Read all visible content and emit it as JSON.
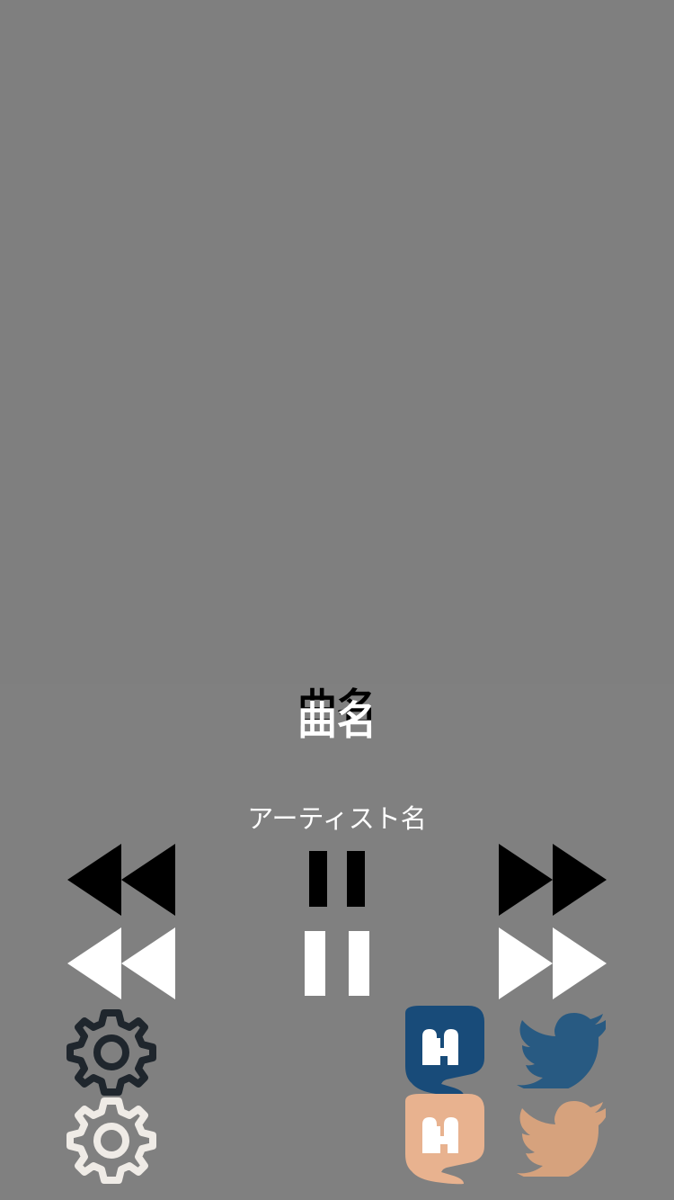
{
  "song": {
    "title": "曲名"
  },
  "artist": {
    "name": "アーティスト名"
  },
  "controls": {
    "previous_icon": "rewind-icon",
    "play_pause_icon": "pause-icon",
    "next_icon": "fast-forward-icon"
  },
  "footer": {
    "settings_icon": "gear-icon",
    "mastodon_icon": "mastodon-icon",
    "twitter_icon": "twitter-icon"
  },
  "colors": {
    "background": "#808080",
    "foreground": "#ffffff",
    "shadow": "#000000",
    "settings_dark": "#1f262d",
    "settings_light": "#efebe6",
    "mastodon_dark": "#184b79",
    "mastodon_light": "#e8b28f",
    "twitter_dark": "#285a82",
    "twitter_light": "#d6a27d"
  }
}
